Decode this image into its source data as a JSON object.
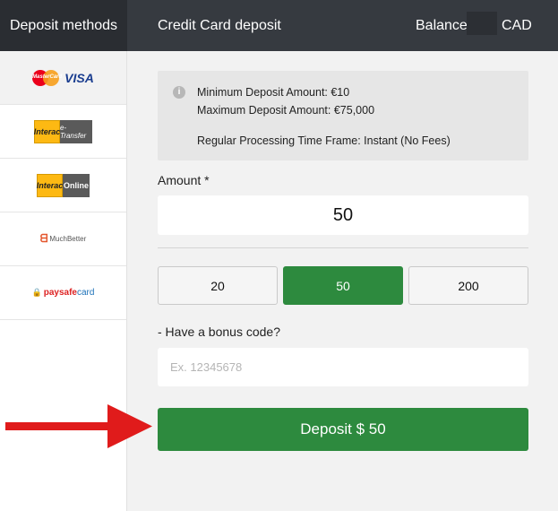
{
  "header": {
    "methods_tab": "Deposit methods",
    "title": "Credit Card deposit",
    "balance_label": "Balance",
    "balance_currency": "CAD"
  },
  "sidebar": {
    "items": [
      {
        "name": "mastercard-visa",
        "mc_text": "MasterCard",
        "visa_text": "VISA",
        "active": true
      },
      {
        "name": "interac-etransfer",
        "box_text": "Interac",
        "tag_text": "e-Transfer"
      },
      {
        "name": "interac-online",
        "box_text": "Interac",
        "tag_text": "Online"
      },
      {
        "name": "muchbetter",
        "text": "MuchBetter"
      },
      {
        "name": "paysafecard",
        "text_a": "paysafe",
        "text_b": "card"
      }
    ]
  },
  "info": {
    "min": "Minimum Deposit Amount: €10",
    "max": "Maximum Deposit Amount: €75,000",
    "processing": "Regular Processing Time Frame: Instant (No Fees)"
  },
  "amount": {
    "label": "Amount *",
    "value": "50",
    "presets": [
      "20",
      "50",
      "200"
    ],
    "selected_preset": "50"
  },
  "bonus": {
    "label": "- Have a bonus code?",
    "placeholder": "Ex. 12345678"
  },
  "deposit_button": "Deposit $ 50",
  "colors": {
    "header_bg": "#363a40",
    "accent_green": "#2d8a3e",
    "arrow_red": "#e01b1b"
  },
  "icons": [
    "info-icon",
    "mastercard-logo-icon",
    "visa-logo-icon",
    "interac-logo-icon",
    "muchbetter-logo-icon",
    "paysafecard-logo-icon",
    "red-arrow-icon"
  ]
}
